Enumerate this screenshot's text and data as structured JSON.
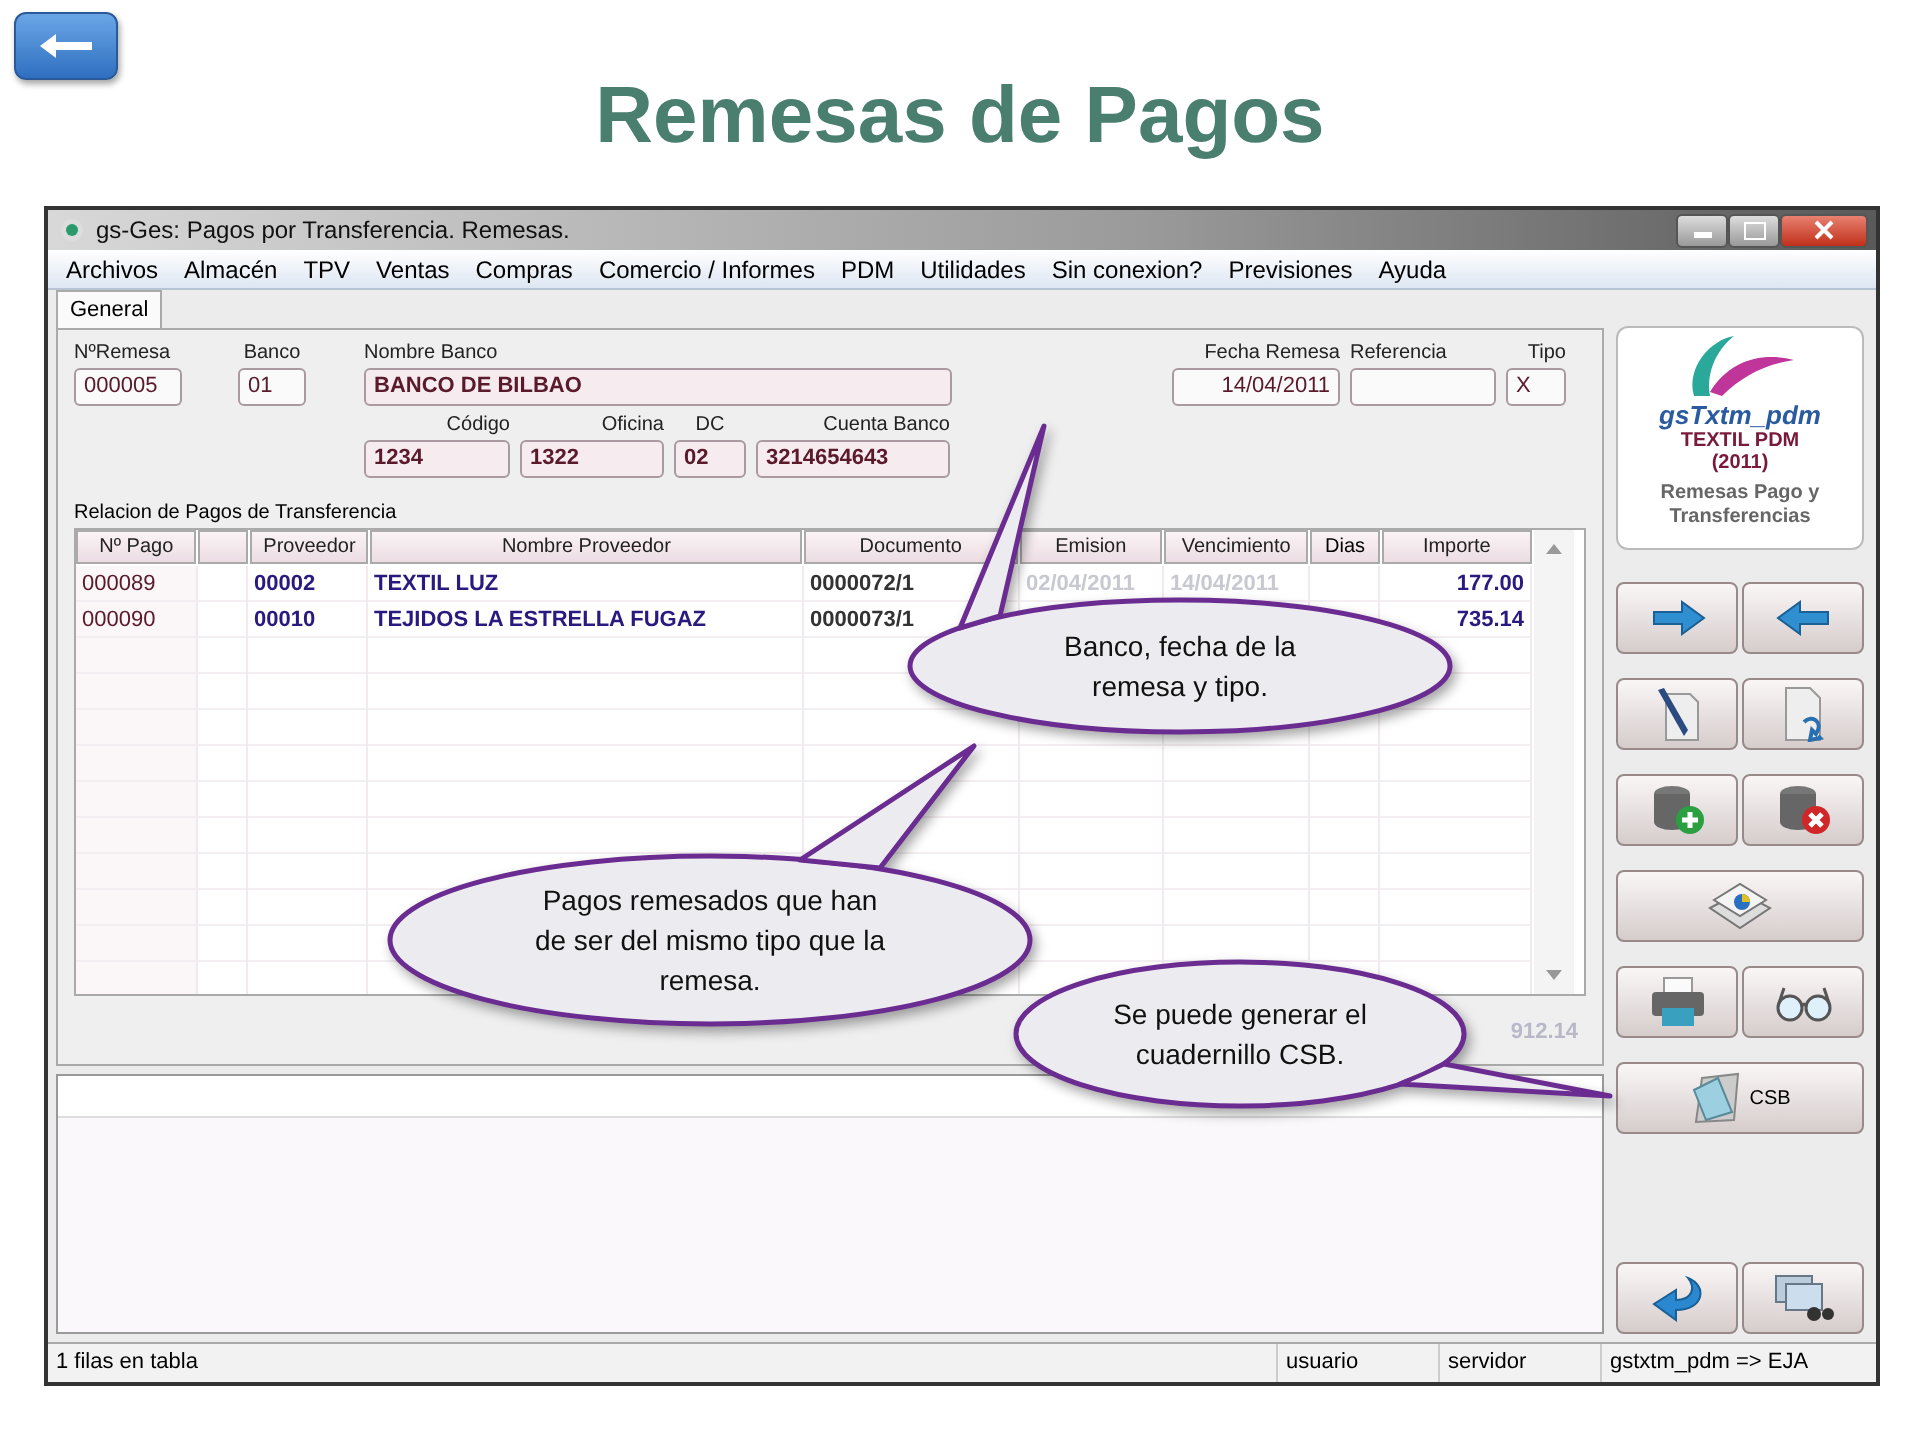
{
  "slide_title": "Remesas de Pagos",
  "window": {
    "title": "gs-Ges: Pagos por Transferencia. Remesas."
  },
  "menu": [
    "Archivos",
    "Almacén",
    "TPV",
    "Ventas",
    "Compras",
    "Comercio / Informes",
    "PDM",
    "Utilidades",
    "Sin conexion?",
    "Previsiones",
    "Ayuda"
  ],
  "tabs": [
    {
      "label": "General",
      "selected": true
    }
  ],
  "form": {
    "remesa": {
      "label": "NºRemesa",
      "value": "000005"
    },
    "banco": {
      "label": "Banco",
      "value": "01"
    },
    "nombre_banco": {
      "label": "Nombre Banco",
      "value": "BANCO DE BILBAO"
    },
    "codigo": {
      "label": "Código",
      "value": "1234"
    },
    "oficina": {
      "label": "Oficina",
      "value": "1322"
    },
    "dc": {
      "label": "DC",
      "value": "02"
    },
    "cuenta": {
      "label": "Cuenta Banco",
      "value": "3214654643"
    },
    "fecha": {
      "label": "Fecha Remesa",
      "value": "14/04/2011"
    },
    "referencia": {
      "label": "Referencia"
    },
    "tipo": {
      "label": "Tipo",
      "value": "X"
    }
  },
  "table": {
    "title": "Relacion de Pagos de Transferencia",
    "columns": [
      "Nº Pago",
      "Proveedor",
      "Nombre Proveedor",
      "Documento",
      "Emision",
      "Vencimiento",
      "Dias",
      "Importe"
    ],
    "rows": [
      {
        "n_pago": "000089",
        "proveedor": "00002",
        "nombre_proveedor": "TEXTIL LUZ",
        "documento": "0000072/1",
        "emision": "02/04/2011",
        "vencimiento": "14/04/2011",
        "importe": "177.00"
      },
      {
        "n_pago": "000090",
        "proveedor": "00010",
        "nombre_proveedor": "TEJIDOS LA ESTRELLA FUGAZ",
        "documento": "0000073/1",
        "importe": "735.14"
      }
    ],
    "total": "912.14"
  },
  "logo": {
    "name": "gsTxtm_pdm",
    "subtitle": "TEXTIL PDM",
    "year": "(2011)",
    "caption": "Remesas Pago y Transferencias"
  },
  "csb_button": {
    "label": "CSB"
  },
  "status_bar": [
    "1 filas en tabla",
    "usuario",
    "servidor",
    "gstxtm_pdm => EJA"
  ],
  "callouts": [
    {
      "text": "Banco, fecha de la remesa y tipo."
    },
    {
      "text": "Pagos remesados que han de ser del mismo tipo que la remesa."
    },
    {
      "text": "Se puede generar el cuadernillo CSB."
    }
  ]
}
